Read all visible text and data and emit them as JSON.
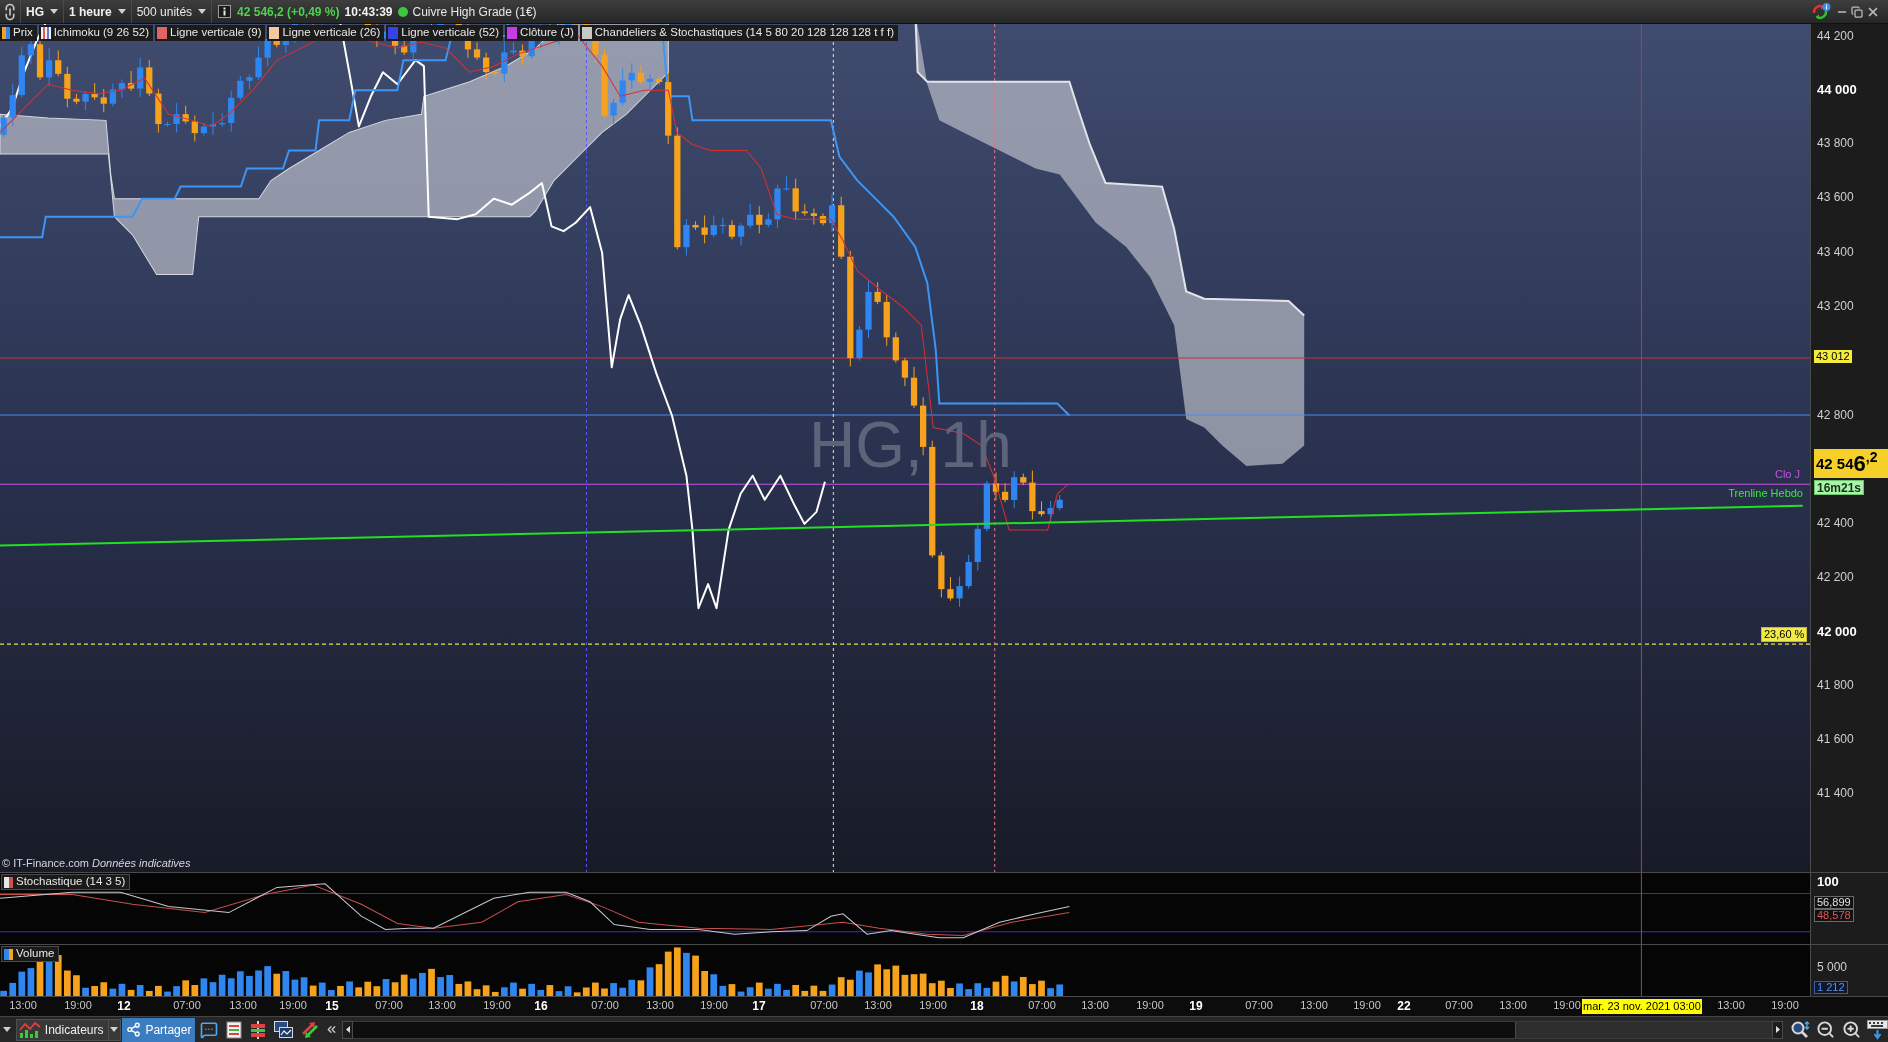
{
  "toolbar": {
    "symbol": "HG",
    "interval": "1 heure",
    "units": "500 unités",
    "quote": "42 546,2 (+0,49 %)",
    "time": "10:43:39",
    "connected": true,
    "instrument": "Cuivre High Grade (1€)"
  },
  "legend": [
    {
      "kind": "candles",
      "label": "Prix"
    },
    {
      "kind": "ichimoku",
      "label": "Ichimoku (9 26 52)"
    },
    {
      "kind": "line",
      "label": "Ligne verticale (9)",
      "color": "#e06464"
    },
    {
      "kind": "line",
      "label": "Ligne verticale (26)",
      "color": "#f6c8a0"
    },
    {
      "kind": "line",
      "label": "Ligne verticale (52)",
      "color": "#3444e8"
    },
    {
      "kind": "line",
      "label": "Clôture (J)",
      "color": "#c83ce8"
    },
    {
      "kind": "line",
      "label": "Chandeliers & Stochastiques (14 5 80 20 128 128 128 t f f)",
      "color": "#c8c8c8"
    }
  ],
  "price_chart": {
    "watermark": "HG, 1h",
    "line_labels": [
      {
        "text": "Clo J",
        "color": "#c850e8"
      },
      {
        "text": "Trenline Hebdo",
        "color": "#3ce83c"
      }
    ],
    "level_label": "23,60 %",
    "credit": "© IT-Finance.com *Données indicatives*"
  },
  "price_axis": {
    "ticks": [
      {
        "text": "44 200",
        "kind": "minor"
      },
      {
        "text": "44 000",
        "kind": "major"
      },
      {
        "text": "43 800",
        "kind": "minor"
      },
      {
        "text": "43 600",
        "kind": "minor"
      },
      {
        "text": "43 400",
        "kind": "minor"
      },
      {
        "text": "43 200",
        "kind": "minor"
      },
      {
        "text": "42 800",
        "kind": "minor"
      },
      {
        "text": "42 400",
        "kind": "minor"
      },
      {
        "text": "42 200",
        "kind": "minor"
      },
      {
        "text": "42 000",
        "kind": "major"
      },
      {
        "text": "41 800",
        "kind": "minor"
      },
      {
        "text": "41 600",
        "kind": "minor"
      },
      {
        "text": "41 400",
        "kind": "minor"
      }
    ],
    "level_marker": "43 012",
    "last_price": "42 54**6**$^{,2}$",
    "countdown": "16m21s"
  },
  "stochastic": {
    "title": "Stochastique (14 3 5)",
    "tick": "100",
    "values": [
      {
        "text": "56,899",
        "color": "#e0e0e0"
      },
      {
        "text": "48,578",
        "color": "#e05454"
      }
    ]
  },
  "volume": {
    "title": "Volume",
    "tick": "5 000",
    "value": "1 212"
  },
  "time_axis": {
    "labels": [
      {
        "text": "13:00",
        "kind": "hour"
      },
      {
        "text": "19:00",
        "kind": "hour"
      },
      {
        "text": "12",
        "kind": "day"
      },
      {
        "text": "07:00",
        "kind": "hour"
      },
      {
        "text": "13:00",
        "kind": "hour"
      },
      {
        "text": "19:00",
        "kind": "hour"
      },
      {
        "text": "15",
        "kind": "day"
      },
      {
        "text": "07:00",
        "kind": "hour"
      },
      {
        "text": "13:00",
        "kind": "hour"
      },
      {
        "text": "19:00",
        "kind": "hour"
      },
      {
        "text": "16",
        "kind": "day"
      },
      {
        "text": "07:00",
        "kind": "hour"
      },
      {
        "text": "13:00",
        "kind": "hour"
      },
      {
        "text": "19:00",
        "kind": "hour"
      },
      {
        "text": "17",
        "kind": "day"
      },
      {
        "text": "07:00",
        "kind": "hour"
      },
      {
        "text": "13:00",
        "kind": "hour"
      },
      {
        "text": "19:00",
        "kind": "hour"
      },
      {
        "text": "18",
        "kind": "day"
      },
      {
        "text": "07:00",
        "kind": "hour"
      },
      {
        "text": "13:00",
        "kind": "hour"
      },
      {
        "text": "19:00",
        "kind": "hour"
      },
      {
        "text": "19",
        "kind": "day"
      },
      {
        "text": "07:00",
        "kind": "hour"
      },
      {
        "text": "13:00",
        "kind": "hour"
      },
      {
        "text": "19:00",
        "kind": "hour"
      },
      {
        "text": "22",
        "kind": "day"
      },
      {
        "text": "07:00",
        "kind": "hour"
      },
      {
        "text": "13:00",
        "kind": "hour"
      },
      {
        "text": "19:00",
        "kind": "hour"
      },
      {
        "text": "13:00",
        "kind": "hour"
      },
      {
        "text": "19:00",
        "kind": "hour"
      }
    ],
    "cursor_label": "mar. 23 nov. 2021 03:00"
  },
  "bottom_toolbar": {
    "indicators": "Indicateurs",
    "share": "Partager"
  }
}
